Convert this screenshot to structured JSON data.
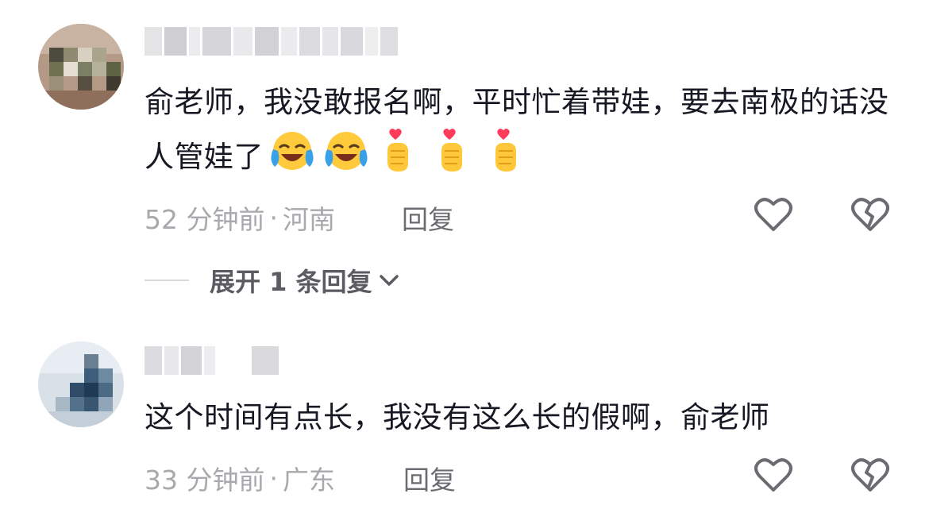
{
  "comments": [
    {
      "username": "",
      "text": "俞老师，我没敢报名啊，平时忙着带娃，要去南极的话没人管娃了",
      "emojis": [
        "laughing-crying-icon",
        "laughing-crying-icon",
        "finger-heart-icon",
        "finger-heart-icon",
        "finger-heart-icon"
      ],
      "time": "52 分钟前",
      "separator": "·",
      "location": "河南",
      "reply_label": "回复",
      "expand_label": "展开 1 条回复",
      "like_icon": "heart-outline-icon",
      "dislike_icon": "broken-heart-icon"
    },
    {
      "username": "",
      "text": "这个时间有点长，我没有这么长的假啊，俞老师",
      "time": "33 分钟前",
      "separator": "·",
      "location": "广东",
      "reply_label": "回复",
      "like_icon": "heart-outline-icon",
      "dislike_icon": "broken-heart-icon"
    }
  ],
  "colors": {
    "text": "#161823",
    "meta": "#a8a8ad",
    "reply": "#6b6b72",
    "icon": "#6b6b72"
  }
}
